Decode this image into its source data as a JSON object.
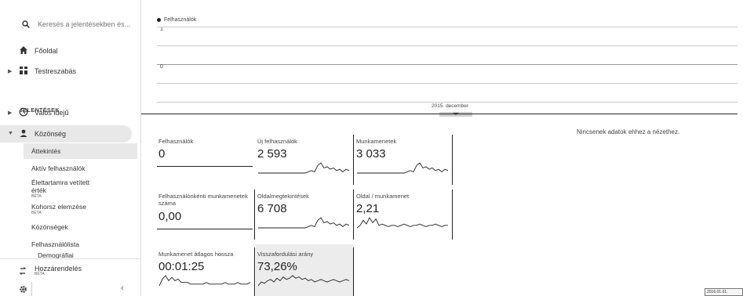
{
  "sidebar": {
    "search_placeholder": "Keresés a jelentésekben és...",
    "home_label": "Főoldal",
    "customize_label": "Testreszabás",
    "reports_section": "JELENTÉSEK",
    "realtime_label": "Valós idejű",
    "audience_label": "Közönség",
    "audience_items": [
      {
        "label": "Áttekintés"
      },
      {
        "label": "Aktív felhasználók"
      },
      {
        "label": "Élettartamra vetített érték",
        "badge": "BÉTA"
      },
      {
        "label": "Kohorsz elemzése",
        "badge": "BÉTA"
      },
      {
        "label": "Közönségek"
      },
      {
        "label": "Felhasználólista"
      },
      {
        "label": "Demográfiai"
      }
    ],
    "acquisition_label": "Hozzárendelés",
    "acquisition_badge": "BÉTA",
    "collapse_icon": "‹"
  },
  "chart": {
    "legend": "Felhasználók",
    "y_top": "1",
    "y_bottom": "0",
    "x_label": "2015. december",
    "series_color": "#222222"
  },
  "metrics": [
    {
      "title": "Felhasználók",
      "value": "0",
      "spark": []
    },
    {
      "title": "Új felhasználók",
      "value": "2 593",
      "spark": [
        0,
        0,
        0,
        0,
        0,
        0,
        0,
        0,
        0,
        0,
        0,
        0,
        0,
        0,
        0,
        0,
        1,
        2,
        1,
        6,
        8,
        4,
        5,
        3,
        4,
        2,
        3,
        1,
        3,
        2
      ]
    },
    {
      "title": "Munkamenetek",
      "value": "3 033",
      "spark": [
        0,
        0,
        0,
        0,
        0,
        0,
        0,
        0,
        0,
        0,
        0,
        0,
        0,
        0,
        0,
        0,
        1,
        2,
        1,
        6,
        8,
        4,
        5,
        3,
        4,
        2,
        3,
        1,
        3,
        2
      ]
    },
    {
      "title": "Felhasználónkénti munkamenetek száma",
      "value": "0,00",
      "spark": []
    },
    {
      "title": "Oldalmegtekintések",
      "value": "6 708",
      "spark": [
        0,
        0,
        0,
        0,
        0,
        0,
        0,
        0,
        0,
        0,
        0,
        0,
        0,
        0,
        0,
        0,
        1,
        2,
        1,
        6,
        8,
        4,
        5,
        3,
        4,
        2,
        3,
        1,
        3,
        2
      ]
    },
    {
      "title": "Oldal / munkamenet",
      "value": "2,21",
      "spark": [
        0,
        2,
        6,
        3,
        8,
        4,
        7,
        2,
        3,
        2,
        1,
        2,
        2,
        1,
        2,
        3,
        2,
        1,
        2,
        2,
        3,
        2,
        1,
        2,
        2,
        3,
        2,
        1,
        2,
        2
      ]
    },
    {
      "title": "Munkamenet átlagos hossza",
      "value": "00:01:25",
      "spark": [
        0,
        4,
        6,
        3,
        5,
        3,
        4,
        2,
        2,
        2,
        1,
        1,
        1,
        1,
        1,
        2,
        1,
        1,
        1,
        1,
        1,
        2,
        1,
        1,
        1,
        2,
        1,
        1,
        1,
        2
      ]
    },
    {
      "title": "Visszafordulási arány",
      "value": "73,26%",
      "spark": [
        0,
        3,
        2,
        4,
        5,
        3,
        6,
        4,
        7,
        5,
        6,
        8,
        6,
        7,
        5,
        6,
        4,
        5,
        3,
        4,
        5,
        4,
        3,
        4,
        5,
        4,
        3,
        4,
        5,
        4
      ]
    }
  ],
  "no_data": "Nincsenek adatok ehhez a nézethez.",
  "corner_box": "2016.01.01."
}
